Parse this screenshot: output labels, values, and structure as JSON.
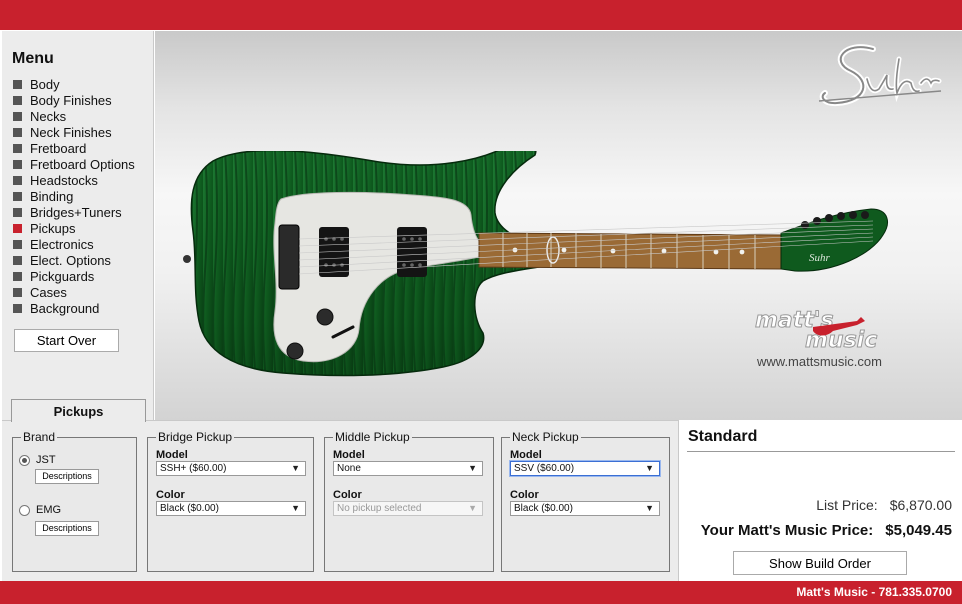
{
  "menu": {
    "title": "Menu",
    "items": [
      {
        "label": "Body",
        "active": false
      },
      {
        "label": "Body Finishes",
        "active": false
      },
      {
        "label": "Necks",
        "active": false
      },
      {
        "label": "Neck Finishes",
        "active": false
      },
      {
        "label": "Fretboard",
        "active": false
      },
      {
        "label": "Fretboard Options",
        "active": false
      },
      {
        "label": "Headstocks",
        "active": false
      },
      {
        "label": "Binding",
        "active": false
      },
      {
        "label": "Bridges+Tuners",
        "active": false
      },
      {
        "label": "Pickups",
        "active": true
      },
      {
        "label": "Electronics",
        "active": false
      },
      {
        "label": "Elect. Options",
        "active": false
      },
      {
        "label": "Pickguards",
        "active": false
      },
      {
        "label": "Cases",
        "active": false
      },
      {
        "label": "Background",
        "active": false
      }
    ],
    "start_over_label": "Start Over"
  },
  "stage": {
    "logo_text": "Suhr",
    "dealer_logo_line1": "matt's",
    "dealer_logo_line2": "music",
    "headstock_logo": "Suhr",
    "dealer_url": "www.mattsmusic.com",
    "body_color": "#0f5a1e",
    "fretboard_color": "#9a6a35",
    "pickguard_color": "#e6e6e2"
  },
  "tab": {
    "label": "Pickups"
  },
  "brand": {
    "legend": "Brand",
    "options": [
      {
        "label": "JST",
        "selected": true,
        "desc_label": "Descriptions"
      },
      {
        "label": "EMG",
        "selected": false,
        "desc_label": "Descriptions"
      }
    ]
  },
  "bridge_pickup": {
    "legend": "Bridge Pickup",
    "model_label": "Model",
    "model_value": "SSH+ ($60.00)",
    "color_label": "Color",
    "color_value": "Black ($0.00)"
  },
  "middle_pickup": {
    "legend": "Middle Pickup",
    "model_label": "Model",
    "model_value": "None",
    "color_label": "Color",
    "color_value": "No pickup selected"
  },
  "neck_pickup": {
    "legend": "Neck Pickup",
    "model_label": "Model",
    "model_value": "SSV ($60.00)",
    "color_label": "Color",
    "color_value": "Black ($0.00)"
  },
  "price": {
    "build_name": "Standard",
    "list_label": "List Price:",
    "list_value": "$6,870.00",
    "your_label": "Your Matt's Music Price:",
    "your_value": "$5,049.45",
    "build_order_label": "Show Build Order"
  },
  "footer": {
    "text": "Matt's Music - 781.335.0700"
  },
  "colors": {
    "brand_red": "#c8212d",
    "panel_gray": "#ececec"
  }
}
